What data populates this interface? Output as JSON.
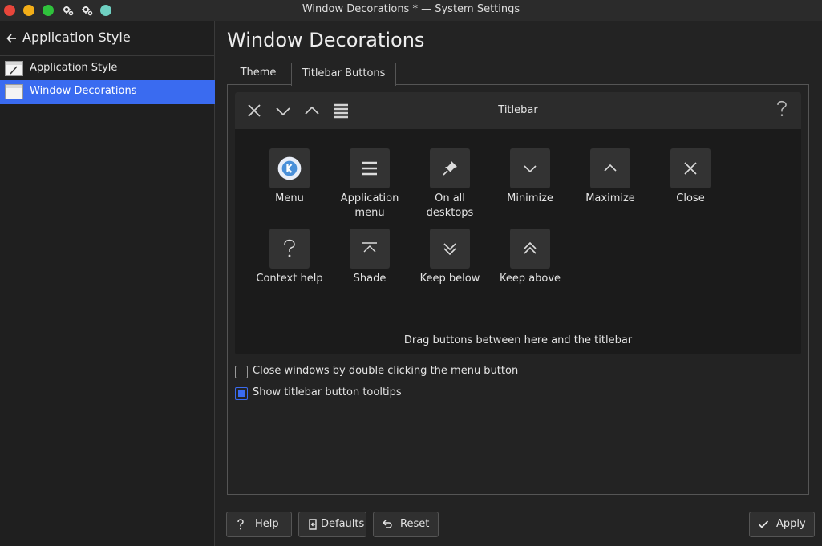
{
  "window": {
    "title": "Window Decorations * — System Settings",
    "controls": [
      "close",
      "minimize",
      "maximize",
      "settings-icon",
      "settings-icon",
      "keep-above"
    ]
  },
  "sidebar": {
    "back_title": "Application Style",
    "items": [
      {
        "label": "Application Style",
        "icon": "app-style-icon",
        "selected": false
      },
      {
        "label": "Window Decorations",
        "icon": "window-icon",
        "selected": true
      }
    ]
  },
  "main": {
    "title": "Window Decorations",
    "tabs": [
      {
        "label": "Theme",
        "active": false
      },
      {
        "label": "Titlebar Buttons",
        "active": true
      }
    ],
    "preview": {
      "titlebar_label": "Titlebar",
      "left_buttons": [
        "close-icon",
        "minimize-icon",
        "maximize-icon",
        "menu-icon"
      ],
      "right_buttons": [
        "help-icon"
      ],
      "available_buttons": [
        {
          "label": "Menu",
          "icon": "kde-logo-icon"
        },
        {
          "label": "Application menu",
          "icon": "hamburger-icon"
        },
        {
          "label": "On all desktops",
          "icon": "pin-icon"
        },
        {
          "label": "Minimize",
          "icon": "chevron-down-icon"
        },
        {
          "label": "Maximize",
          "icon": "chevron-up-icon"
        },
        {
          "label": "Close",
          "icon": "close-icon"
        },
        {
          "label": "Context help",
          "icon": "question-icon"
        },
        {
          "label": "Shade",
          "icon": "shade-icon"
        },
        {
          "label": "Keep below",
          "icon": "double-chevron-down-icon"
        },
        {
          "label": "Keep above",
          "icon": "double-chevron-up-icon"
        }
      ],
      "drag_hint": "Drag buttons between here and the titlebar"
    },
    "options": [
      {
        "label": "Close windows by double clicking the menu button",
        "checked": false
      },
      {
        "label": "Show titlebar button tooltips",
        "checked": true
      }
    ]
  },
  "footer": {
    "help": "Help",
    "defaults": "Defaults",
    "reset": "Reset",
    "apply": "Apply"
  },
  "colors": {
    "accent": "#3a6bf0",
    "background": "#232323",
    "sidebar": "#1f1f1f",
    "close_dot": "#e8463b",
    "minimize_dot": "#f3ae18",
    "maximize_dot": "#2fc23c"
  }
}
